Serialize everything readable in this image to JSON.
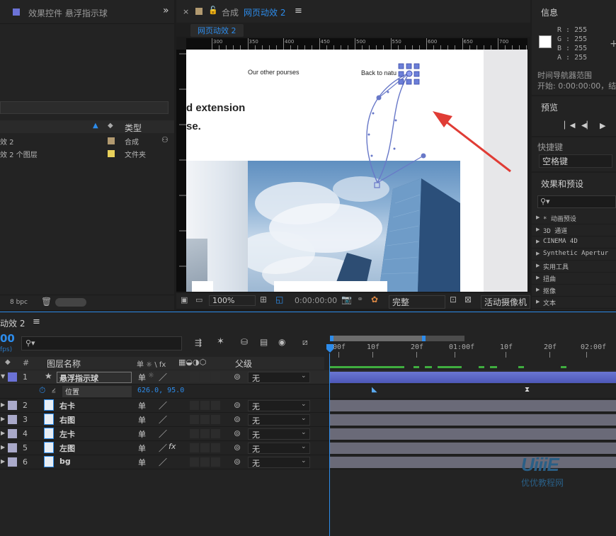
{
  "effects_panel": {
    "tab_title": "效果控件 悬浮指示球",
    "expand": "»",
    "type_header": "类型",
    "rows": [
      {
        "name": "效 2",
        "type": "合成",
        "color": "#b29a70"
      },
      {
        "name": "效 2 个图层",
        "type": "文件夹",
        "color": "#e8d05a"
      }
    ],
    "bpc": "8 bpc"
  },
  "comp_panel": {
    "close": "×",
    "prefix": "合成",
    "name": "网页动效 2",
    "menu": "≡",
    "breadcrumb": "网页动效 2",
    "ruler": [
      "300",
      "350",
      "400",
      "450",
      "500",
      "550",
      "600",
      "650",
      "700",
      "750"
    ],
    "web": {
      "nav1": "Our other pourses",
      "nav2": "Back to natu",
      "line1": "d extension",
      "line2": "se."
    },
    "footer": {
      "zoom": "100%",
      "timecode": "0:00:00:00",
      "quality": "完整",
      "camera": "活动摄像机"
    }
  },
  "info_panel": {
    "title": "信息",
    "r": "R : 255",
    "g": "G : 255",
    "b": "B : 255",
    "a": "A : 255",
    "plus": "+",
    "range_label": "时间导航器范围",
    "start": "开始: 0:00:00:00，结"
  },
  "preview_panel": {
    "title": "预览"
  },
  "shortcut_panel": {
    "title": "快捷键",
    "value": "空格键"
  },
  "effects_presets": {
    "title": "效果和预设",
    "items": [
      "* 动画预设",
      "3D 通道",
      "CINEMA 4D",
      "Synthetic Apertur",
      "实用工具",
      "扭曲",
      "抠像",
      "文本"
    ]
  },
  "timeline": {
    "tab": "动效 2",
    "menu": "≡",
    "timecode": "00",
    "fps": "fps)",
    "col_num": "#",
    "col_name": "图层名称",
    "col_parent": "父级",
    "switch_icons": "单 ☼ \\ fx",
    "ruler": [
      "00f",
      "10f",
      "20f",
      "01:00f",
      "10f",
      "20f",
      "02:00f"
    ],
    "layers": [
      {
        "num": "1",
        "name": "悬浮指示球",
        "color": "#6b72d6",
        "parent": "无",
        "expanded": true,
        "selected": true
      },
      {
        "num": "2",
        "name": "右卡",
        "color": "#a9a9c9",
        "parent": "无"
      },
      {
        "num": "3",
        "name": "右图",
        "color": "#a9a9c9",
        "parent": "无"
      },
      {
        "num": "4",
        "name": "左卡",
        "color": "#a9a9c9",
        "parent": "无"
      },
      {
        "num": "5",
        "name": "左图",
        "color": "#a9a9c9",
        "parent": "无"
      },
      {
        "num": "6",
        "name": "bg",
        "color": "#a9a9c9",
        "parent": "无"
      }
    ],
    "property": {
      "name": "位置",
      "value": "626.0, 95.0"
    },
    "watermark": {
      "logo": "UiiiE",
      "sub": "优优教程网"
    }
  }
}
